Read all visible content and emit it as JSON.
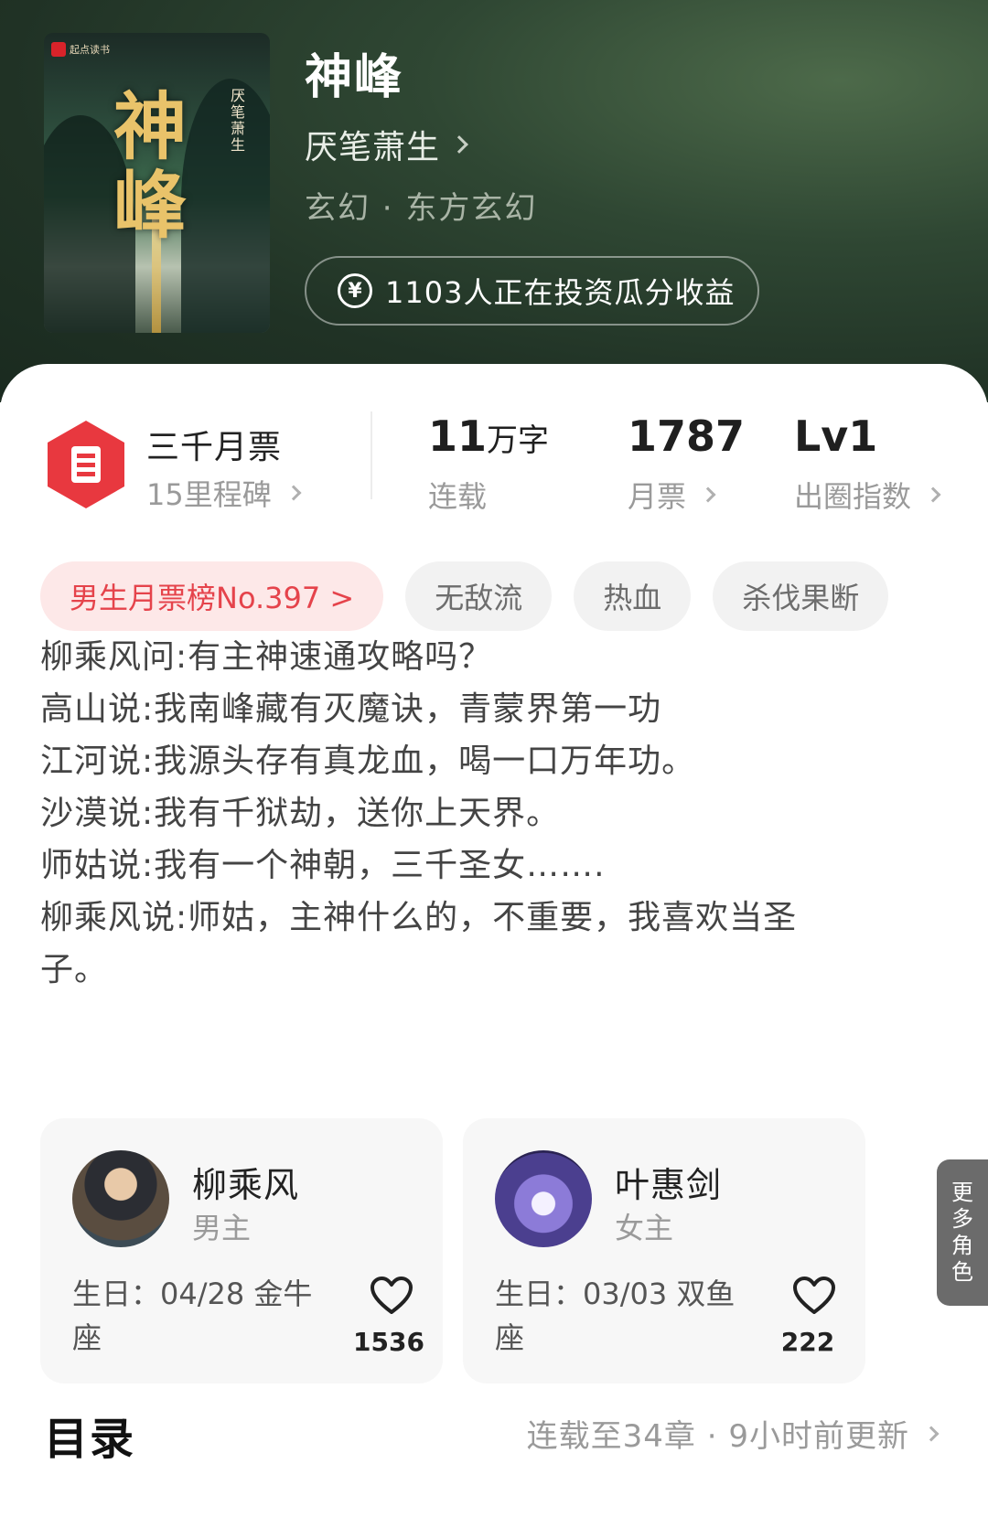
{
  "book": {
    "cover_logo_text": "起点读书",
    "cover_title": "神峰",
    "cover_author": "厌笔萧生",
    "title": "神峰",
    "author": "厌笔萧生",
    "genre": "玄幻 · 东方玄幻",
    "invest_text": "1103人正在投资瓜分收益",
    "invest_icon": "yen-circle-icon"
  },
  "stats": {
    "ticket": {
      "title": "三千月票",
      "subtitle": "15里程碑",
      "icon": "ticket-icon",
      "color": "#e8383f"
    },
    "words": {
      "value": "11",
      "unit": "万字",
      "label": "连载"
    },
    "monthly": {
      "value": "1787",
      "label": "月票"
    },
    "level": {
      "value": "Lv1",
      "label": "出圈指数"
    }
  },
  "tags": {
    "rank": "男生月票榜No.397 >",
    "items": [
      "无敌流",
      "热血",
      "杀伐果断"
    ]
  },
  "intro": "柳乘风问:有主神速通攻略吗？\n高山说:我南峰藏有灭魔诀，青蒙界第一功\n江河说:我源头存有真龙血，喝一口万年功。\n沙漠说:我有千狱劫，送你上天界。\n师姑说:我有一个神朝，三千圣女…….\n柳乘风说:师姑，主神什么的，不重要，我喜欢当圣\n子。",
  "roles": [
    {
      "name": "柳乘风",
      "type": "男主",
      "birthday": "生日：04/28 金牛座",
      "likes": "1536"
    },
    {
      "name": "叶惠剑",
      "type": "女主",
      "birthday": "生日：03/03 双鱼座",
      "likes": "222"
    }
  ],
  "more_roles": [
    "更",
    "多",
    "角",
    "色"
  ],
  "toc": {
    "title": "目录",
    "info": "连载至34章 · 9小时前更新"
  },
  "colors": {
    "header_bg": "#2a3f2e",
    "accent_red": "#e5434b",
    "rank_tag_bg": "#fde8e8"
  }
}
